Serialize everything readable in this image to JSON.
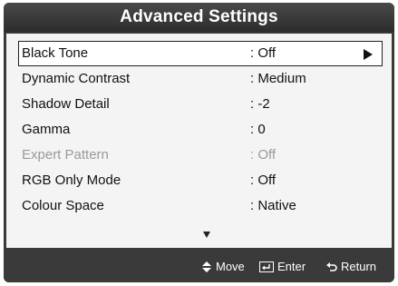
{
  "title": "Advanced Settings",
  "menu": [
    {
      "label": "Black Tone",
      "value": ": Off",
      "selected": true,
      "disabled": false
    },
    {
      "label": "Dynamic Contrast",
      "value": ": Medium",
      "selected": false,
      "disabled": false
    },
    {
      "label": "Shadow Detail",
      "value": ": -2",
      "selected": false,
      "disabled": false
    },
    {
      "label": "Gamma",
      "value": ": 0",
      "selected": false,
      "disabled": false
    },
    {
      "label": "Expert Pattern",
      "value": ": Off",
      "selected": false,
      "disabled": true
    },
    {
      "label": "RGB Only Mode",
      "value": ": Off",
      "selected": false,
      "disabled": false
    },
    {
      "label": "Colour Space",
      "value": ": Native",
      "selected": false,
      "disabled": false
    }
  ],
  "footer": {
    "move_label": "Move",
    "enter_label": "Enter",
    "return_label": "Return"
  },
  "icons": {
    "selection_arrow": "triangle-right-icon",
    "scroll": "triangle-down-icon",
    "move": "up-down-arrows-icon",
    "enter": "enter-icon",
    "return": "return-icon"
  },
  "colors": {
    "frame": "#3a3a3a",
    "panel": "#f4f4f4",
    "text": "#111111",
    "disabled_text": "#9a9a9a"
  }
}
